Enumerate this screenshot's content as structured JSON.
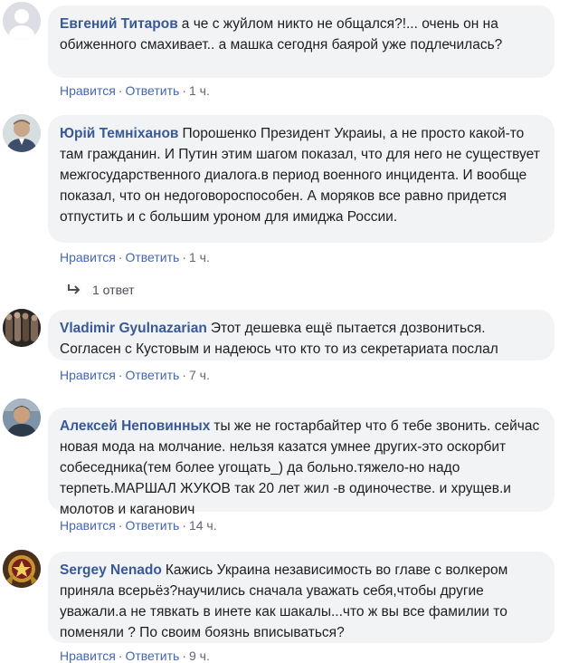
{
  "comments": [
    {
      "author": "Евгений Титаров",
      "text": "а че с жуйлом никто не общался?!... очень он на обиженного смахивает.. а машка сегодня баярой уже подлечилась?",
      "like": "Нравится",
      "reply": "Ответить",
      "time": "1 ч."
    },
    {
      "author": "Юрій Темніханов",
      "text": "Порошенко Президент Украиы, а не просто какой-то там гражданин. И Путин этим шагом показал, что для него не существует межгосударственного диалога.в период военного инцидента. И вообще показал, что он недоговороспособен. А моряков все равно придется отпустить и с большим уроном для имиджа России.",
      "like": "Нравится",
      "reply": "Ответить",
      "time": "1 ч.",
      "replies_label": "1 ответ"
    },
    {
      "author": "Vladimir Gyulnazarian",
      "text": "Этот дешевка ещё пытается дозвониться. Согласен с Кустовым и надеюсь что кто то из секретариата послал",
      "like": "Нравится",
      "reply": "Ответить",
      "time": "7 ч."
    },
    {
      "author": "Алексей Неповинных",
      "text": "ты же не гостарбайтер что б тебе звонить. сейчас новая мода на молчание. нельзя казатся умнее других-это оскорбит собеседника(тем более угощать_) да больно.тяжело-но надо терпеть.МАРШАЛ ЖУКОВ так 20 лет жил -в одиночестве. и хрущев.и молотов и каганович",
      "like": "Нравится",
      "reply": "Ответить",
      "time": "14 ч."
    },
    {
      "author": "Sergey Nenado",
      "text": "Кажись Украина независимость во главе с волкером приняла всерьёз?научились сначала уважать себя,чтобы другие уважали.а не тявкать в инете как шакалы...что ж вы все фамилии то поменяли ? По своим боязнь вписываться?",
      "like": "Нравится",
      "reply": "Ответить",
      "time": "9 ч."
    }
  ],
  "separator": "·",
  "colors": {
    "author": "#385898",
    "link": "#4267b2",
    "bubble": "#f2f3f5",
    "meta": "#606770"
  }
}
